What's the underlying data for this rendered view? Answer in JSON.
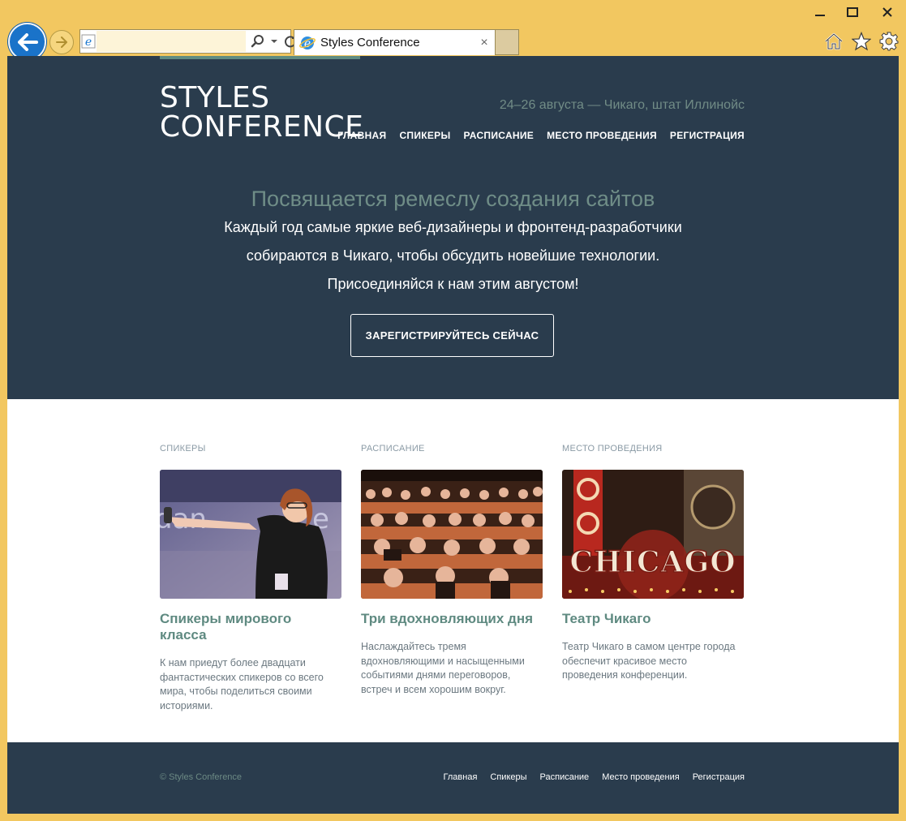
{
  "browser": {
    "address_value": "",
    "tab_title": "Styles Conference",
    "tab_close_glyph": "×"
  },
  "site": {
    "logo_line1": "STYLES",
    "logo_line2": "CONFERENCE",
    "tagline": "24–26 августа — Чикаго, штат Иллинойс",
    "nav": [
      "ГЛАВНАЯ",
      "СПИКЕРЫ",
      "РАСПИСАНИЕ",
      "МЕСТО ПРОВЕДЕНИЯ",
      "РЕГИСТРАЦИЯ"
    ]
  },
  "hero": {
    "title": "Посвящается ремеслу создания сайтов",
    "line1": "Каждый год самые яркие веб-дизайнеры и фронтенд-разработчики",
    "line2": "собираются в Чикаго, чтобы обсудить новейшие технологии.",
    "line3": "Присоединяйся к нам этим августом!",
    "cta": "ЗАРЕГИСТРИРУЙТЕСЬ СЕЙЧАС"
  },
  "teasers": [
    {
      "kicker": "СПИКЕРЫ",
      "title": "Спикеры мирового класса",
      "text": "К нам приедут более двадцати фантастических спикеров со всего мира, чтобы поделиться своими историями."
    },
    {
      "kicker": "РАСПИСАНИЕ",
      "title": "Три вдохновляющих дня",
      "text": "Наслаждайтесь тремя вдохновляющими и насыщенными событиями днями переговоров, встреч и всем хорошим вокруг."
    },
    {
      "kicker": "МЕСТО ПРОВЕДЕНИЯ",
      "title": "Театр Чикаго",
      "text": "Театр Чикаго в самом центре города обеспечит красивое место проведения конференции.",
      "sign_text": "CHICAGO"
    }
  ],
  "footer": {
    "copyright": "© Styles Conference",
    "nav": [
      "Главная",
      "Спикеры",
      "Расписание",
      "Место проведения",
      "Регистрация"
    ]
  },
  "colors": {
    "chrome": "#f2c760",
    "header_bg": "#2a3c4d",
    "accent": "#6f8d87",
    "back_button": "#1a73c9"
  },
  "icons": [
    "minimize-icon",
    "maximize-icon",
    "close-icon",
    "back-arrow-icon",
    "forward-arrow-icon",
    "ie-logo-icon",
    "search-icon",
    "dropdown-icon",
    "refresh-icon",
    "home-icon",
    "favorites-star-icon",
    "settings-gear-icon"
  ]
}
